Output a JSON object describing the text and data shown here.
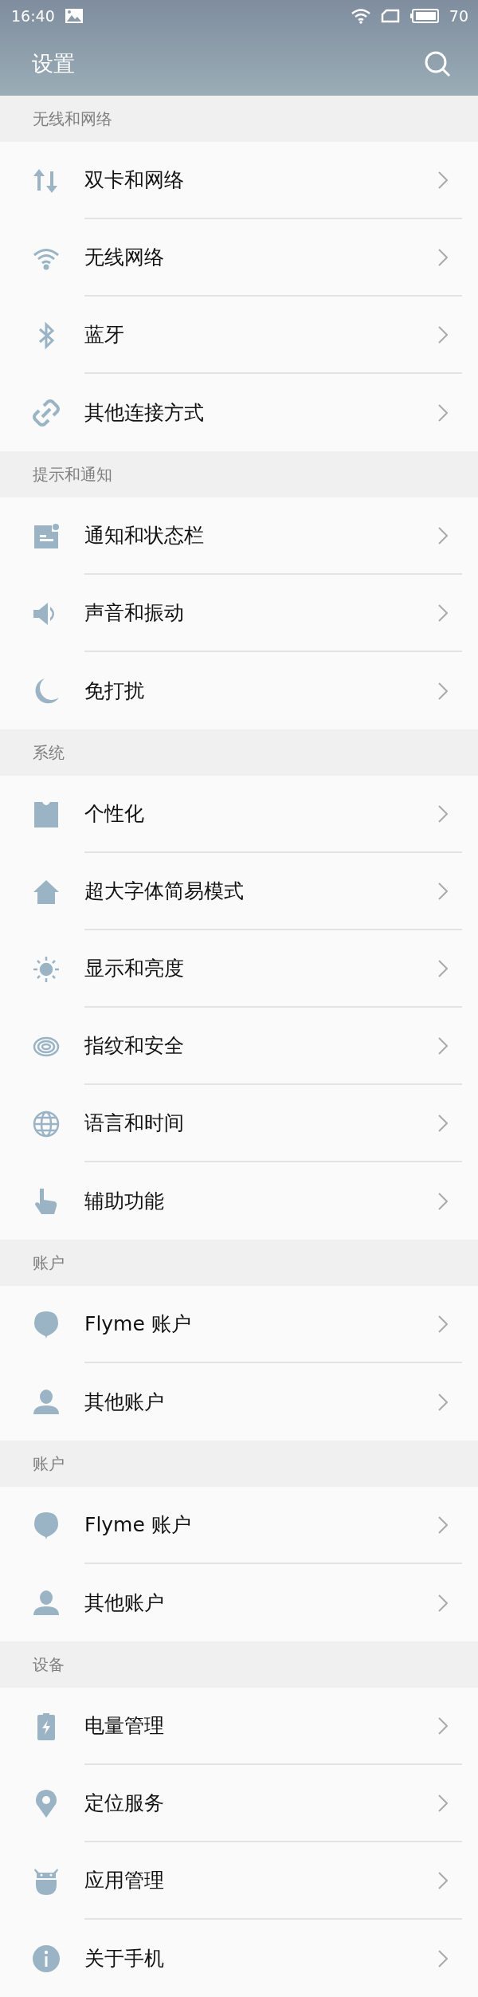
{
  "status_bar": {
    "time": "16:40",
    "battery": "70"
  },
  "app_bar": {
    "title": "设置"
  },
  "sections": [
    {
      "title": "无线和网络",
      "items": [
        {
          "label": "双卡和网络",
          "kind": "data"
        },
        {
          "label": "无线网络",
          "kind": "wifi"
        },
        {
          "label": "蓝牙",
          "kind": "bluetooth"
        },
        {
          "label": "其他连接方式",
          "kind": "link"
        }
      ]
    },
    {
      "title": "提示和通知",
      "items": [
        {
          "label": "通知和状态栏",
          "kind": "notification"
        },
        {
          "label": "声音和振动",
          "kind": "sound"
        },
        {
          "label": "免打扰",
          "kind": "moon"
        }
      ]
    },
    {
      "title": "系统",
      "items": [
        {
          "label": "个性化",
          "kind": "shirt"
        },
        {
          "label": "超大字体简易模式",
          "kind": "home"
        },
        {
          "label": "显示和亮度",
          "kind": "sun"
        },
        {
          "label": "指纹和安全",
          "kind": "fingerprint"
        },
        {
          "label": "语言和时间",
          "kind": "globe"
        },
        {
          "label": "辅助功能",
          "kind": "hand"
        }
      ]
    },
    {
      "title": "账户",
      "items": [
        {
          "label": "Flyme 账户",
          "kind": "balloon"
        },
        {
          "label": "其他账户",
          "kind": "person"
        }
      ]
    },
    {
      "title": "账户",
      "items": [
        {
          "label": "Flyme 账户",
          "kind": "balloon"
        },
        {
          "label": "其他账户",
          "kind": "person"
        }
      ]
    },
    {
      "title": "设备",
      "items": [
        {
          "label": "电量管理",
          "kind": "battery"
        },
        {
          "label": "定位服务",
          "kind": "location"
        },
        {
          "label": "应用管理",
          "kind": "android"
        },
        {
          "label": "关于手机",
          "kind": "info"
        }
      ]
    }
  ]
}
